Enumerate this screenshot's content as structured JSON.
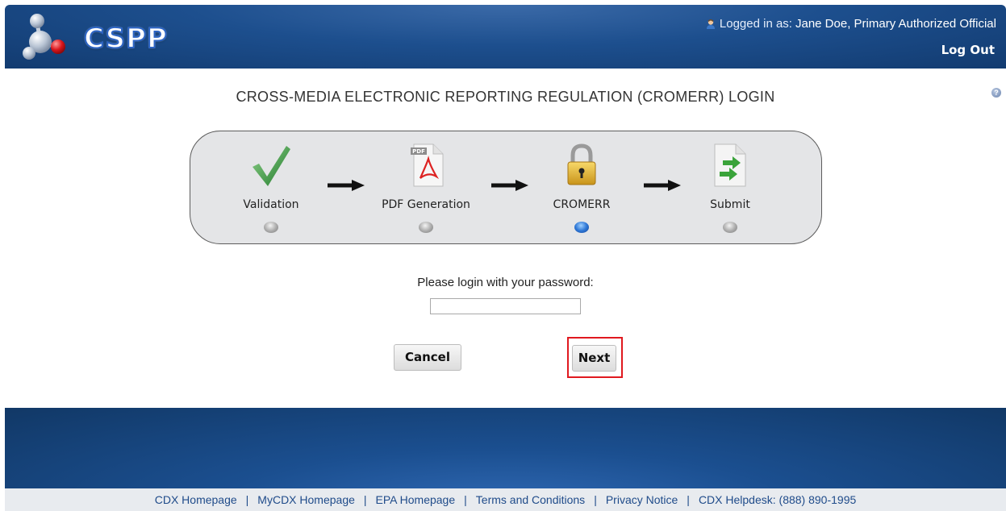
{
  "header": {
    "app_name": "CSPP",
    "logged_in_prefix": "Logged in as:",
    "logged_in_user": "Jane Doe, Primary Authorized Official",
    "logout_label": "Log Out"
  },
  "page": {
    "title": "CROSS-MEDIA ELECTRONIC REPORTING REGULATION (CROMERR) LOGIN",
    "help_icon": "help-icon"
  },
  "steps": [
    {
      "label": "Validation",
      "icon": "checkmark-icon",
      "active": false
    },
    {
      "label": "PDF Generation",
      "icon": "pdf-file-icon",
      "active": false
    },
    {
      "label": "CROMERR",
      "icon": "lock-icon",
      "active": true
    },
    {
      "label": "Submit",
      "icon": "submit-document-icon",
      "active": false
    }
  ],
  "login": {
    "prompt": "Please login with your password:",
    "password_value": "",
    "cancel_label": "Cancel",
    "next_label": "Next"
  },
  "footer": {
    "links": [
      "CDX Homepage",
      "MyCDX Homepage",
      "EPA Homepage",
      "Terms and Conditions",
      "Privacy Notice",
      "CDX Helpdesk: (888) 890-1995"
    ],
    "separator": "|"
  },
  "colors": {
    "header_blue": "#1d4f8e",
    "active_step": "#2f78d6",
    "highlight_red": "#e0191f"
  }
}
